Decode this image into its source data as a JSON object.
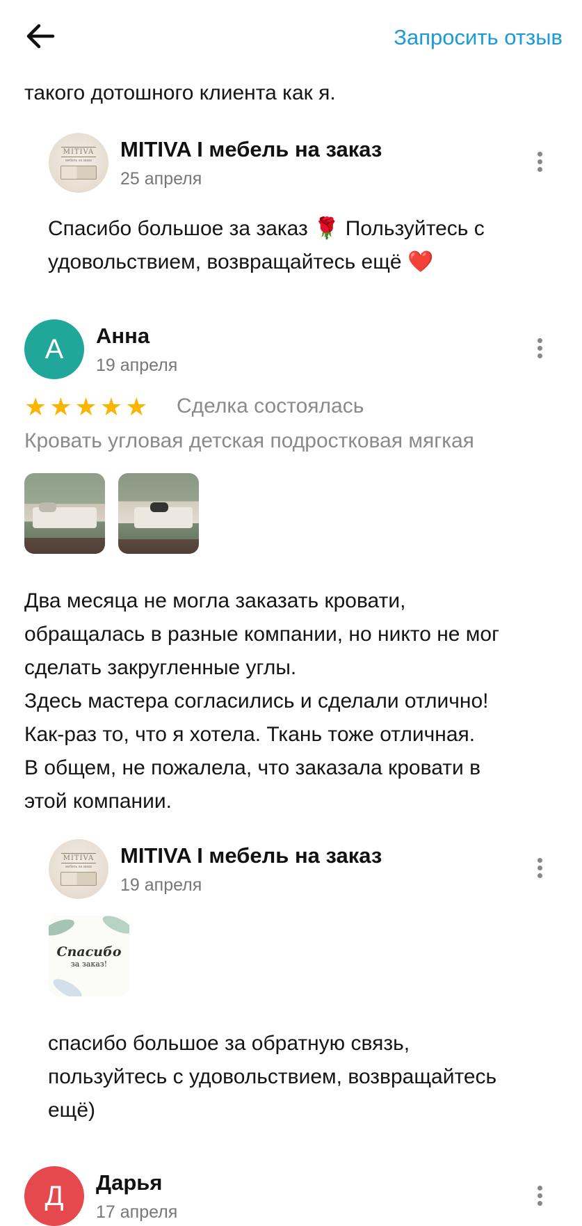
{
  "header": {
    "back_icon": "arrow-left-icon",
    "request_review_label": "Запросить отзыв"
  },
  "fragment_text": "такого дотошного клиента как я.",
  "reply1": {
    "author": "MITIVA  I  мебель на заказ",
    "date": "25 апреля",
    "text_line1": "Спасибо большое за заказ 🌹 Пользуйтесь с",
    "text_line2": "удовольствием, возвращайтесь ещё ❤️"
  },
  "review1": {
    "avatar_letter": "А",
    "avatar_color": "#21a69a",
    "author": "Анна",
    "date": "19 апреля",
    "rating": 5,
    "stars": "★★★★★",
    "deal_status": "Сделка состоялась",
    "product": "Кровать угловая детская подростковая мягкая",
    "text_lines": [
      "Два месяца не могла заказать кровати,",
      "обращалась в разные компании, но никто не мог",
      "сделать закругленные углы.",
      "Здесь мастера согласились и сделали отлично!",
      "Как-раз то, что я хотела. Ткань тоже отличная.",
      "В общем, не пожалела, что заказала кровати в",
      "этой компании."
    ]
  },
  "reply2": {
    "author": "MITIVA  I  мебель на заказ",
    "date": "19 апреля",
    "card_line1": "Спасибо",
    "card_line2": "за заказ!",
    "text_lines": [
      "спасибо большое за обратную связь,",
      "пользуйтесь с удовольствием, возвращайтесь",
      "ещё)"
    ]
  },
  "review2": {
    "avatar_letter": "Д",
    "avatar_color": "#e5484d",
    "author": "Дарья",
    "date": "17 апреля"
  },
  "logo_text": "MITIVA",
  "logo_subtext": "мебель на заказ"
}
